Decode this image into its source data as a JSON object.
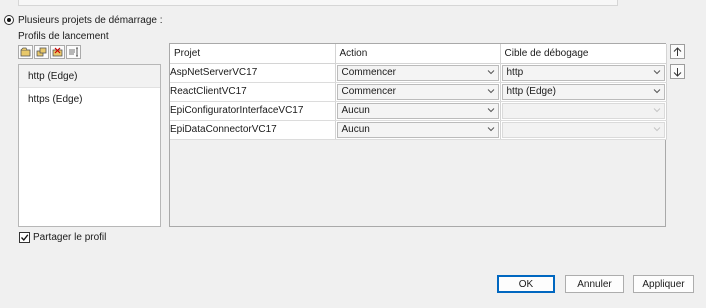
{
  "startup": {
    "radio_label": "Plusieurs projets de démarrage :",
    "selected": true
  },
  "profiles": {
    "section_label": "Profils de lancement",
    "toolbar": [
      {
        "icon": "new-profile-icon"
      },
      {
        "icon": "copy-profile-icon"
      },
      {
        "icon": "delete-profile-icon"
      },
      {
        "icon": "rename-profile-icon"
      }
    ],
    "items": [
      {
        "label": "http (Edge)",
        "selected": true
      },
      {
        "label": "https (Edge)",
        "selected": false
      }
    ],
    "share_label": "Partager le profil",
    "share_checked": true
  },
  "grid": {
    "columns": [
      "Projet",
      "Action",
      "Cible de débogage"
    ],
    "rows": [
      {
        "project": "AspNetServerVC17",
        "action": "Commencer",
        "target": "http",
        "target_enabled": true
      },
      {
        "project": "ReactClientVC17",
        "action": "Commencer",
        "target": "http (Edge)",
        "target_enabled": true
      },
      {
        "project": "EpiConfiguratorInterfaceVC17",
        "action": "Aucun",
        "target": "",
        "target_enabled": false
      },
      {
        "project": "EpiDataConnectorVC17",
        "action": "Aucun",
        "target": "",
        "target_enabled": false
      }
    ]
  },
  "side_buttons": {
    "up_icon": "arrow-up-icon",
    "down_icon": "arrow-down-icon"
  },
  "buttons": {
    "ok": "OK",
    "cancel": "Annuler",
    "apply": "Appliquer"
  }
}
